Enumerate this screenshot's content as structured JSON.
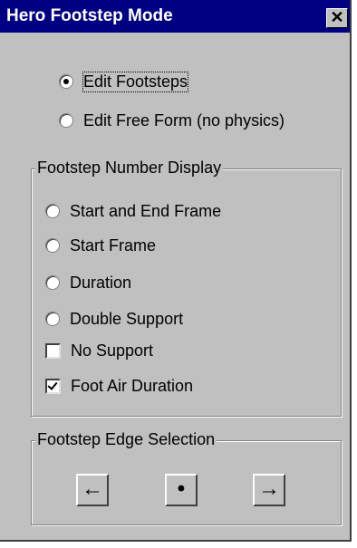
{
  "window": {
    "title": "Hero Footstep Mode",
    "close_glyph": "✕"
  },
  "mode": {
    "options": [
      {
        "label": "Edit Footsteps",
        "checked": true
      },
      {
        "label": "Edit Free Form (no physics)",
        "checked": false
      }
    ]
  },
  "number_display": {
    "legend": "Footstep Number Display",
    "radios": [
      {
        "label": "Start and End Frame",
        "checked": false
      },
      {
        "label": "Start Frame",
        "checked": false
      },
      {
        "label": "Duration",
        "checked": false
      },
      {
        "label": "Double Support",
        "checked": false
      }
    ],
    "checkboxes": [
      {
        "label": "No Support",
        "checked": false
      },
      {
        "label": "Foot Air Duration",
        "checked": true
      }
    ]
  },
  "edge_selection": {
    "legend": "Footstep Edge Selection",
    "buttons": [
      {
        "glyph": "←",
        "icon": "arrow-left-icon"
      },
      {
        "glyph": "•",
        "icon": "dot-icon"
      },
      {
        "glyph": "→",
        "icon": "arrow-right-icon"
      }
    ]
  }
}
